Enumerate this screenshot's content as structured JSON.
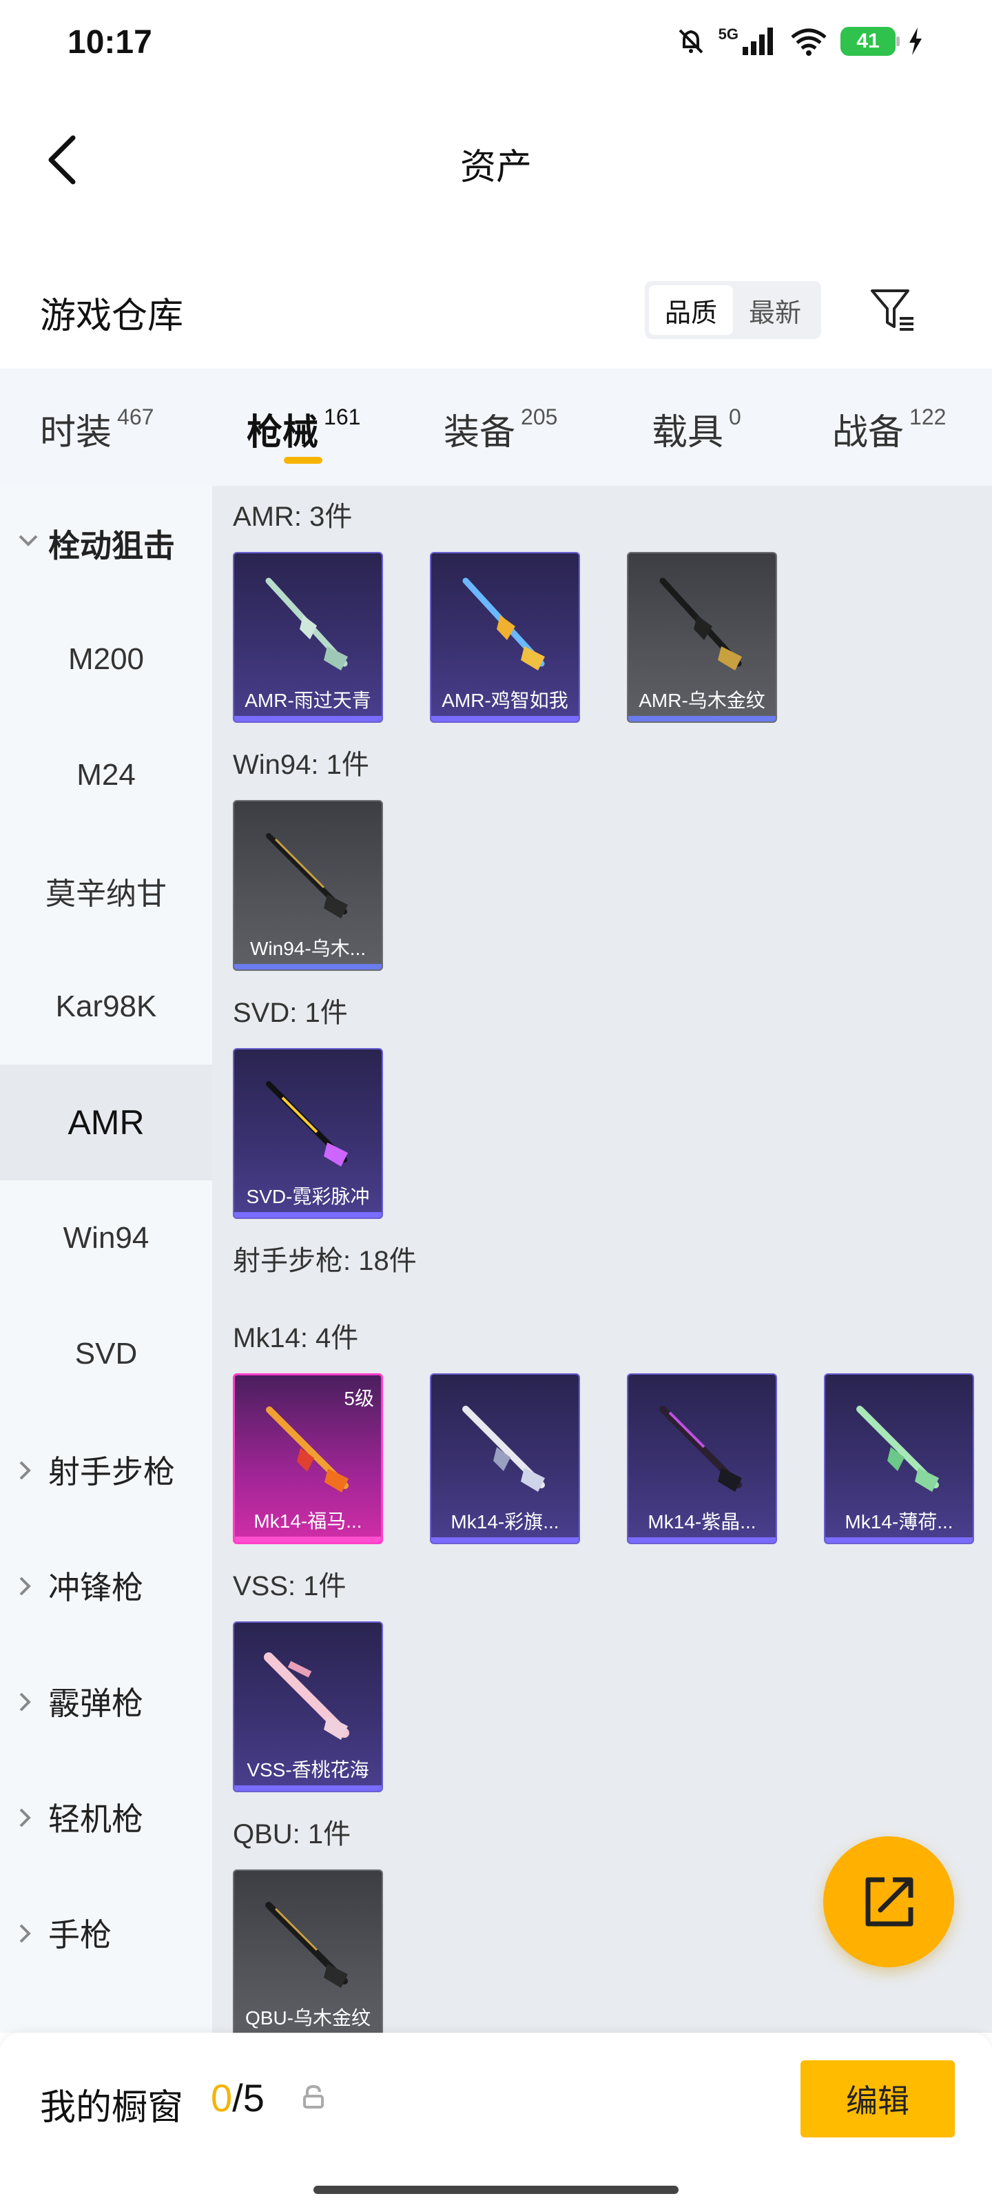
{
  "status_bar": {
    "time": "10:17",
    "network": "5G",
    "battery": "41"
  },
  "header": {
    "title": "资产"
  },
  "warehouse": {
    "title": "游戏仓库",
    "sort_options": [
      "品质",
      "最新"
    ]
  },
  "category_tabs": [
    {
      "label": "时装",
      "count": "467"
    },
    {
      "label": "枪械",
      "count": "161"
    },
    {
      "label": "装备",
      "count": "205"
    },
    {
      "label": "载具",
      "count": "0"
    },
    {
      "label": "战备",
      "count": "122"
    }
  ],
  "sidebar": {
    "group_open": "栓动狙击",
    "sub_items": [
      "M200",
      "M24",
      "莫辛纳甘",
      "Kar98K",
      "AMR",
      "Win94",
      "SVD"
    ],
    "groups_closed": [
      "射手步枪",
      "冲锋枪",
      "霰弹枪",
      "轻机枪",
      "手枪"
    ]
  },
  "sections": [
    {
      "title": "AMR: 3件",
      "items": [
        {
          "name": "AMR-雨过天青",
          "rarity": "purple"
        },
        {
          "name": "AMR-鸡智如我",
          "rarity": "purple"
        },
        {
          "name": "AMR-乌木金纹",
          "rarity": "gray"
        }
      ]
    },
    {
      "title": "Win94: 1件",
      "items": [
        {
          "name": "Win94-乌木...",
          "rarity": "gray"
        }
      ]
    },
    {
      "title": "SVD: 1件",
      "items": [
        {
          "name": "SVD-霓彩脉冲",
          "rarity": "purple"
        }
      ]
    },
    {
      "title": "射手步枪: 18件",
      "items": []
    },
    {
      "title": "Mk14: 4件",
      "items": [
        {
          "name": "Mk14-福马...",
          "rarity": "pink",
          "level": "5级"
        },
        {
          "name": "Mk14-彩旗...",
          "rarity": "purple"
        },
        {
          "name": "Mk14-紫晶...",
          "rarity": "purple"
        },
        {
          "name": "Mk14-薄荷...",
          "rarity": "purple"
        }
      ]
    },
    {
      "title": "VSS: 1件",
      "items": [
        {
          "name": "VSS-香桃花海",
          "rarity": "purple"
        }
      ]
    },
    {
      "title": "QBU: 1件",
      "items": [
        {
          "name": "QBU-乌木金纹",
          "rarity": "gray"
        }
      ]
    }
  ],
  "bottom_bar": {
    "label": "我的橱窗",
    "current": "0",
    "separator": "/",
    "total": "5",
    "edit_label": "编辑"
  },
  "colors": {
    "accent": "#ffbb00",
    "purple_card": "#3a3170",
    "gray_card": "#52545a",
    "pink_card": "#d22ea8"
  }
}
